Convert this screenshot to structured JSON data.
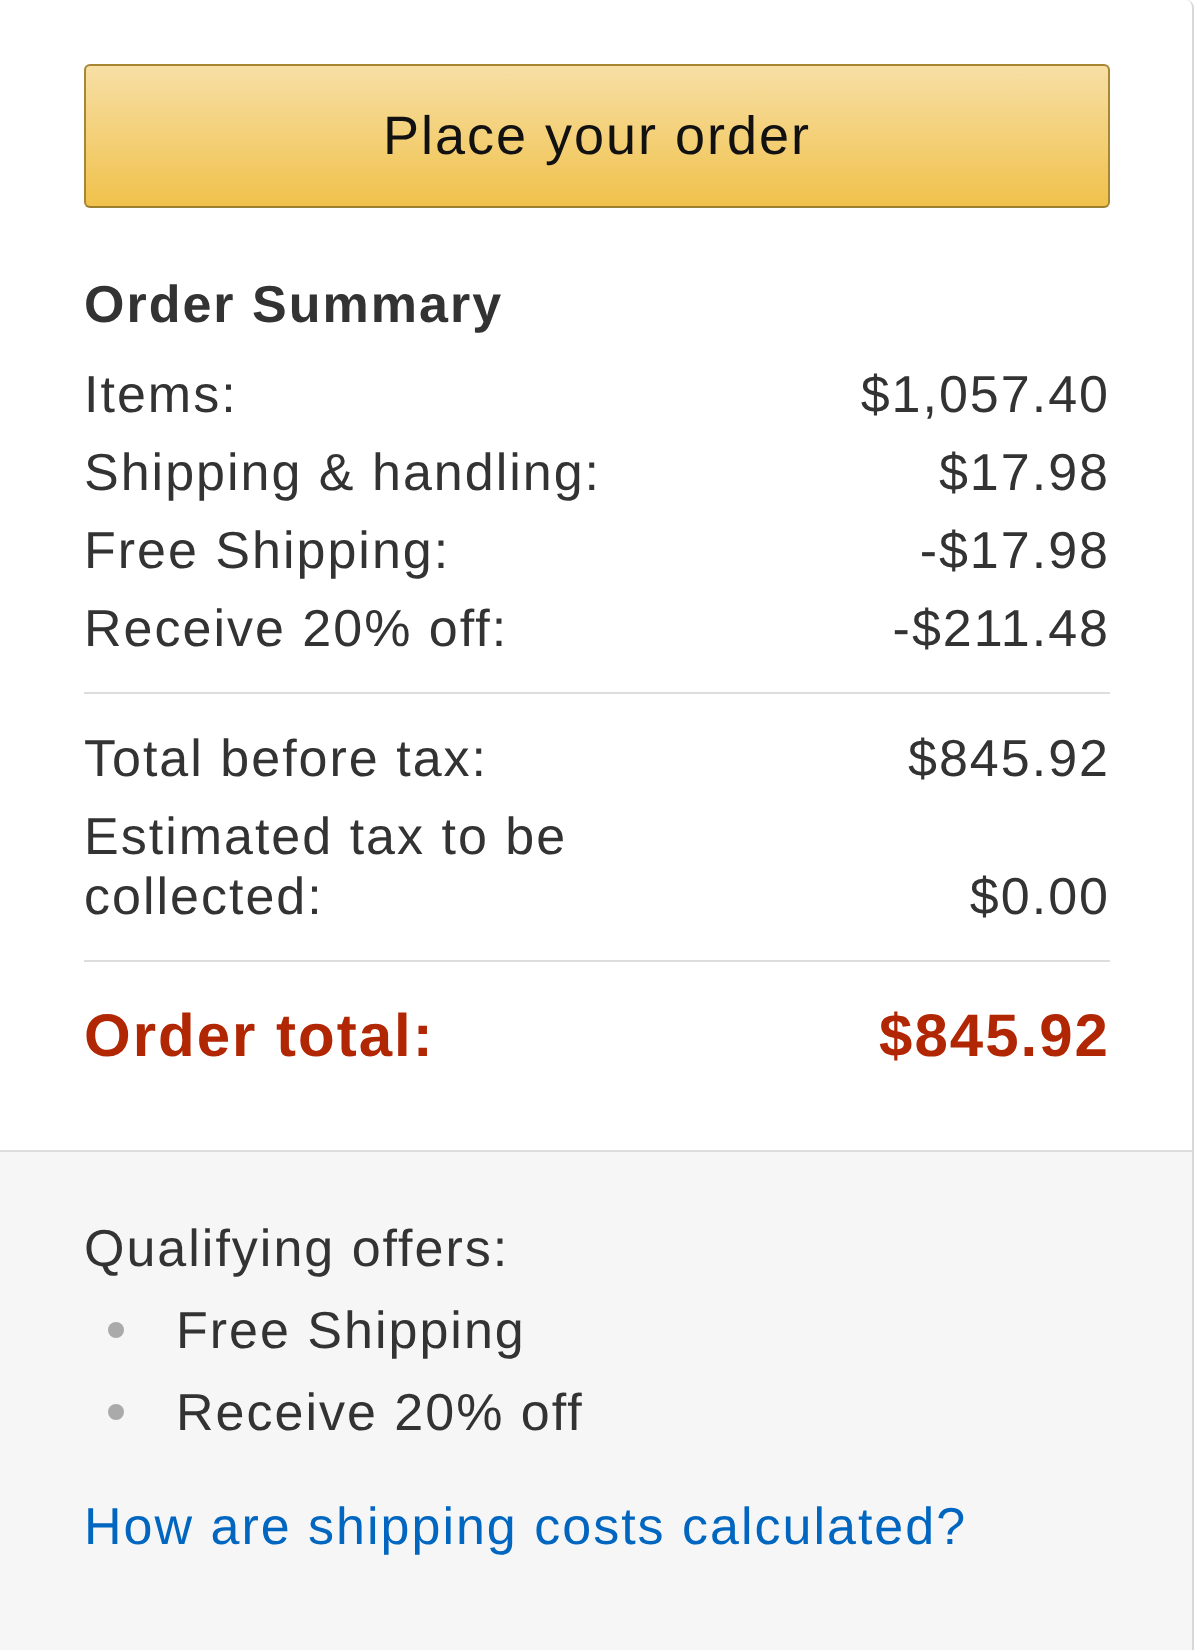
{
  "button": {
    "label": "Place your order"
  },
  "summary": {
    "title": "Order Summary",
    "groups": [
      [
        {
          "label": "Items:",
          "value": "$1,057.40"
        },
        {
          "label": "Shipping & handling:",
          "value": "$17.98"
        },
        {
          "label": "Free Shipping:",
          "value": "-$17.98"
        },
        {
          "label": "Receive 20% off:",
          "value": "-$211.48"
        }
      ],
      [
        {
          "label": "Total before tax:",
          "value": "$845.92"
        },
        {
          "label": "Estimated tax to be collected:",
          "value": "$0.00"
        }
      ]
    ],
    "total": {
      "label": "Order total:",
      "value": "$845.92"
    }
  },
  "offers": {
    "title": "Qualifying offers:",
    "items": [
      "Free Shipping",
      "Receive 20% off"
    ],
    "link": "How are shipping costs calculated?"
  }
}
